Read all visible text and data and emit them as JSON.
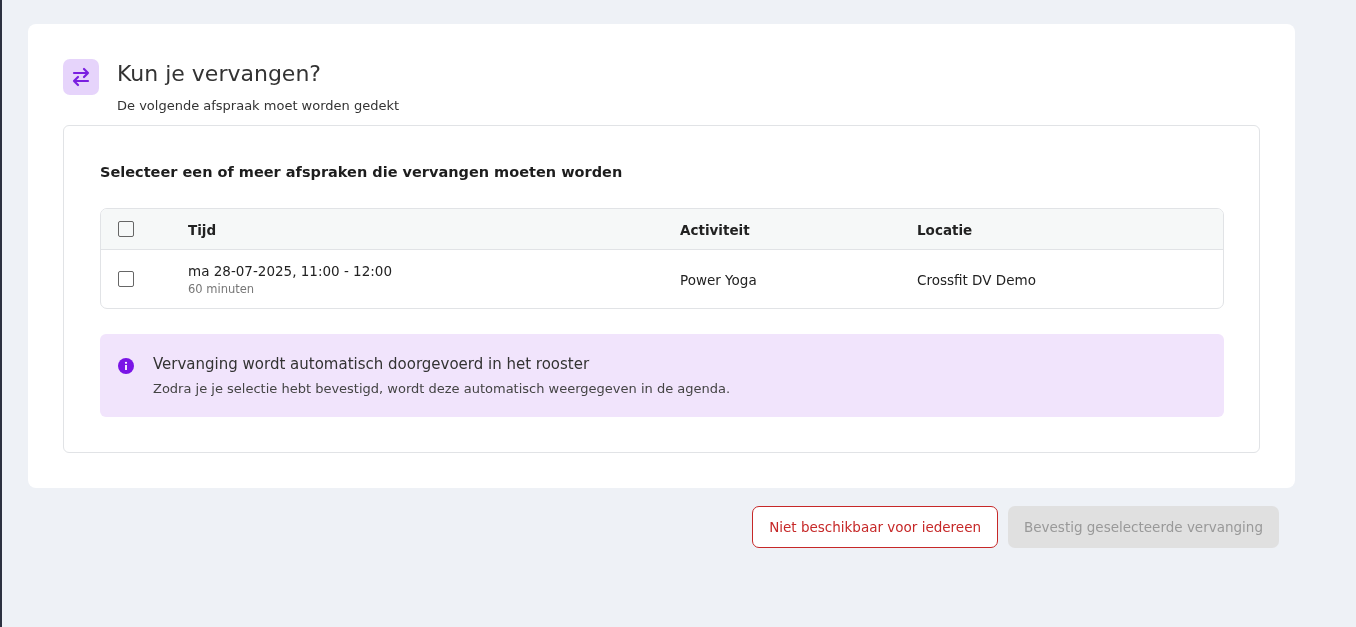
{
  "header": {
    "title": "Kun je vervangen?",
    "subtitle": "De volgende afspraak moet worden gedekt"
  },
  "panel": {
    "instruction": "Selecteer een of meer afspraken die vervangen moeten worden",
    "table": {
      "select_all": {
        "checked": false
      },
      "columns": [
        "Tijd",
        "Activiteit",
        "Locatie"
      ],
      "rows": [
        {
          "checked": false,
          "time": "ma 28-07-2025, 11:00 - 12:00",
          "duration": "60 minuten",
          "activity": "Power Yoga",
          "location": "Crossfit DV Demo"
        }
      ]
    },
    "notice": {
      "title": "Vervanging wordt automatisch doorgevoerd in het rooster",
      "text": "Zodra je je selectie hebt bevestigd, wordt deze automatisch weergegeven in de agenda."
    }
  },
  "buttons": [
    {
      "kind": "outline",
      "label": "Niet beschikbaar voor iedereen",
      "disabled": false
    },
    {
      "kind": "primary",
      "label": "Bevestig geselecteerde vervanging",
      "disabled": true
    }
  ]
}
